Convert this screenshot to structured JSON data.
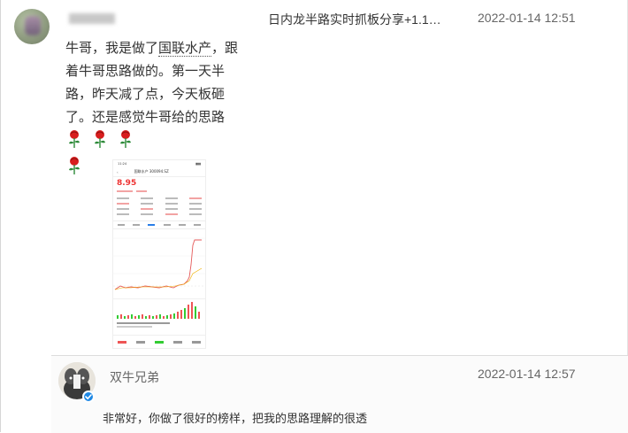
{
  "comment1": {
    "username": "",
    "post_title": "日内龙半路实时抓板分享+1.1…",
    "time": "2022-01-14 12:51",
    "text_before_link": "牛哥，我是做了",
    "link_text": "国联水产",
    "text_after_link": "，跟着牛哥思路做的。第一天半路，昨天减了点，今天板砸了。还是感觉牛哥给的思路",
    "emoji": "rose-icon"
  },
  "screenshot": {
    "time": "11:24",
    "stock_name": "国联水产 300094.SZ",
    "price": "8.95"
  },
  "reply": {
    "username": "双牛兄弟",
    "time": "2022-01-14 12:57",
    "text": "非常好，你做了很好的榜样，把我的思路理解的很透"
  },
  "colors": {
    "rose": "#d81e1e",
    "stem": "#2e8b3a",
    "verified": "#1e88e5"
  }
}
